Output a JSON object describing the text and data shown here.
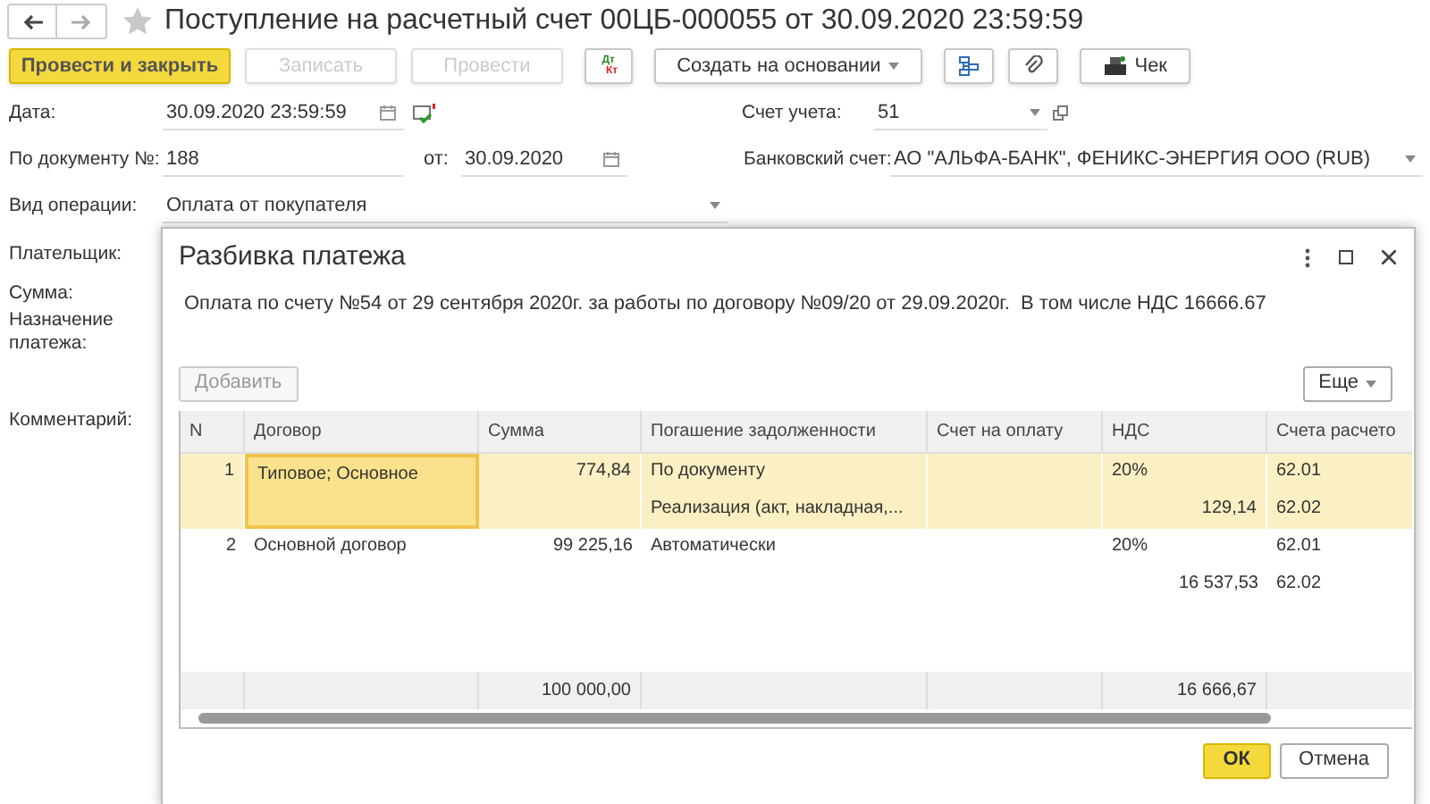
{
  "window": {
    "title": "Поступление на расчетный счет 00ЦБ-000055 от 30.09.2020 23:59:59",
    "favorite": false
  },
  "toolbar": [
    {
      "kind": "primary",
      "label": "Провести и закрыть",
      "disabled": false
    },
    {
      "kind": "normal",
      "label": "Записать",
      "disabled": true
    },
    {
      "kind": "normal",
      "label": "Провести",
      "disabled": true
    },
    {
      "kind": "dtkt",
      "debit": "Дт",
      "credit": "Кт",
      "disabled": false
    },
    {
      "kind": "menu",
      "label": "Создать на основании",
      "disabled": false
    },
    {
      "kind": "structure",
      "disabled": false
    },
    {
      "kind": "clip",
      "disabled": false
    },
    {
      "kind": "cash",
      "label": "Чек",
      "disabled": false
    }
  ],
  "fields": {
    "date": {
      "label": "Дата:",
      "value": "30.09.2020 23:59:59"
    },
    "doc_number": {
      "label": "По документу №:",
      "value": "188"
    },
    "doc_date": {
      "label": "от:",
      "value": "30.09.2020"
    },
    "operation": {
      "label": "Вид операции:",
      "value": "Оплата от покупателя"
    },
    "account": {
      "label": "Счет учета:",
      "value": "51"
    },
    "bank_account": {
      "label": "Банковский счет:",
      "value": "АО \"АЛЬФА-БАНК\", ФЕНИКС-ЭНЕРГИЯ ООО (RUB)"
    }
  },
  "side_labels": [
    "Плательщик:",
    "Сумма:",
    "Назначение платежа:",
    "Комментарий:"
  ],
  "dialog": {
    "title": "Разбивка платежа",
    "description": "Оплата по счету №54 от 29 сентября 2020г. за работы по договору №09/20 от 29.09.2020г.  В том числе НДС 16666.67",
    "add_button": {
      "label": "Добавить",
      "disabled": true
    },
    "more_button": "Еще",
    "table": {
      "columns": [
        "N",
        "Договор",
        "Сумма",
        "Погашение задолженности",
        "Счет на оплату",
        "НДС",
        "Счета расчето"
      ],
      "rows": [
        {
          "number": "1",
          "contract": "Типовое; Основное",
          "amount": "774,84",
          "repayment": [
            "По документу",
            "Реализация (акт, накладная,..."
          ],
          "vat_rate": "20%",
          "vat_amount": "129,14",
          "accounts": [
            "62.01",
            "62.02"
          ],
          "selected": true,
          "focused": true
        },
        {
          "number": "2",
          "contract": "Основной договор",
          "amount": "99 225,16",
          "repayment": [
            "Автоматически"
          ],
          "vat_rate": "20%",
          "vat_amount": "16 537,53",
          "accounts": [
            "62.01",
            "62.02"
          ],
          "selected": false,
          "focused": false
        }
      ],
      "totals": {
        "amount": "100 000,00",
        "vat_amount": "16 666,67"
      }
    },
    "buttons": [
      {
        "kind": "primary",
        "label": "ОК"
      },
      {
        "kind": "normal",
        "label": "Отмена"
      }
    ]
  }
}
